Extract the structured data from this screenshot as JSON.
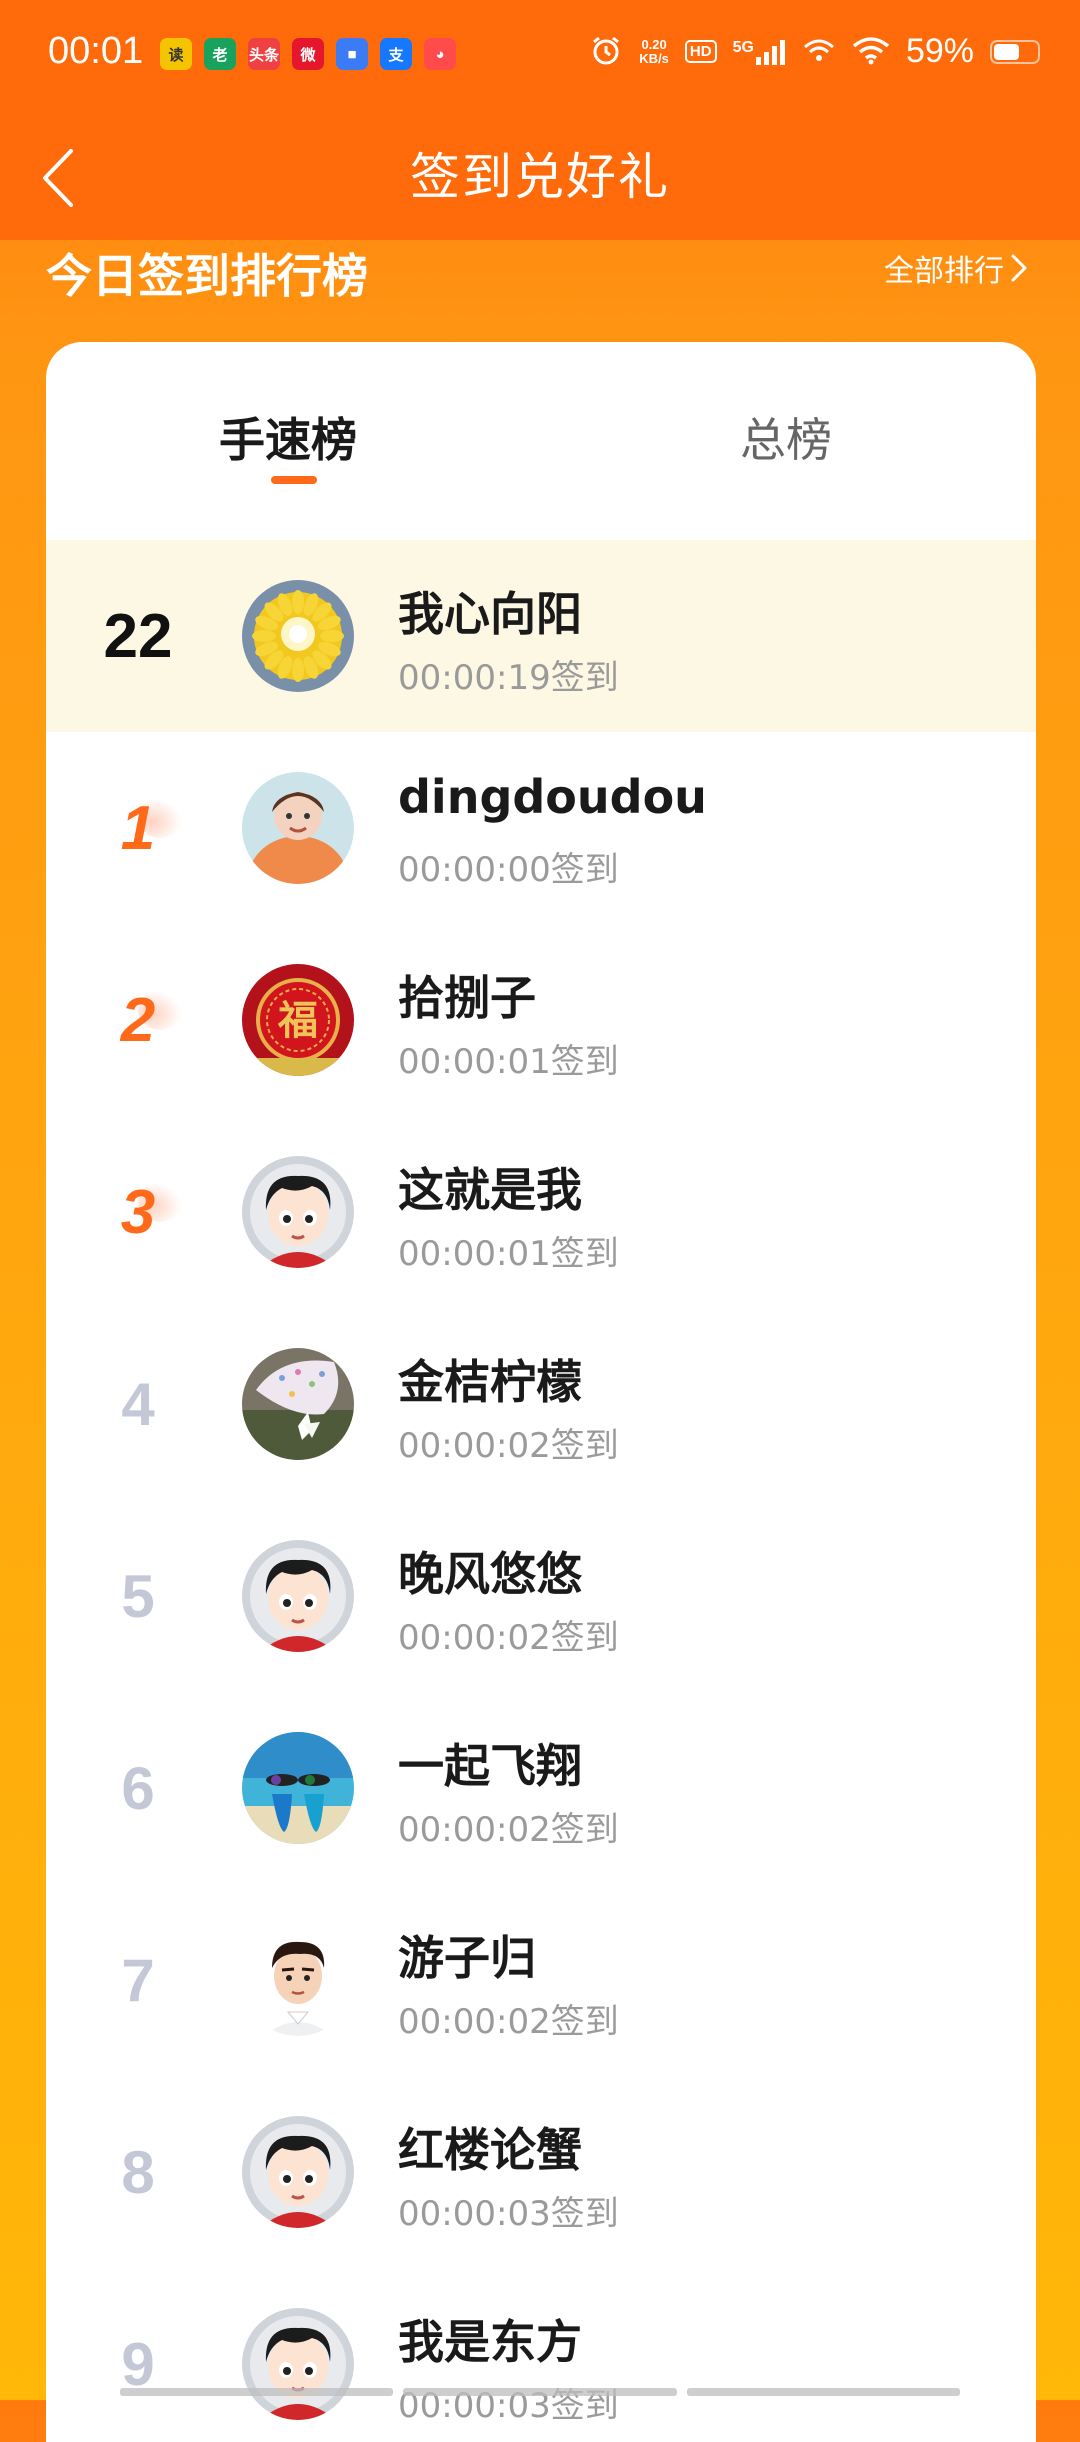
{
  "status_bar": {
    "time": "00:01",
    "app_icons": [
      {
        "label": "读",
        "color": "#F5C400",
        "text_color": "#333",
        "name": "reading-app-icon"
      },
      {
        "label": "老",
        "color": "#19A25B",
        "text_color": "#fff",
        "name": "elder-app-icon"
      },
      {
        "label": "头条",
        "color": "#F04142",
        "text_color": "#fff",
        "name": "toutiao-app-icon"
      },
      {
        "label": "微",
        "color": "#E6162D",
        "text_color": "#fff",
        "name": "weibo-app-icon"
      },
      {
        "label": "■",
        "color": "#3B7BF5",
        "text_color": "#fff",
        "name": "card-app-icon"
      },
      {
        "label": "支",
        "color": "#1677FF",
        "text_color": "#fff",
        "name": "alipay-app-icon"
      },
      {
        "label": "◕",
        "color": "#FF4B4B",
        "text_color": "#fff",
        "name": "mascot-app-icon"
      }
    ],
    "net_speed": "0.20",
    "net_unit": "KB/s",
    "hd_label": "HD",
    "network": "5G",
    "battery_percent": "59%",
    "battery_level": 0.59
  },
  "nav": {
    "title": "签到兑好礼"
  },
  "section": {
    "title": "今日签到排行榜",
    "all_ranking": "全部排行"
  },
  "tabs": [
    {
      "label": "手速榜",
      "active": true
    },
    {
      "label": "总榜",
      "active": false
    }
  ],
  "my_entry": {
    "rank": "22",
    "name": "我心向阳",
    "time": "00:00:19签到",
    "avatar": "sunflower"
  },
  "entries": [
    {
      "rank": "1",
      "name": "dingdoudou",
      "time": "00:00:00签到",
      "avatar": "person-orange"
    },
    {
      "rank": "2",
      "name": "拾捌子",
      "time": "00:00:01签到",
      "avatar": "fu-red"
    },
    {
      "rank": "3",
      "name": "这就是我",
      "time": "00:00:01签到",
      "avatar": "cartoon-default"
    },
    {
      "rank": "4",
      "name": "金桔柠檬",
      "time": "00:00:02签到",
      "avatar": "flower-photo"
    },
    {
      "rank": "5",
      "name": "晚风悠悠",
      "time": "00:00:02签到",
      "avatar": "cartoon-default"
    },
    {
      "rank": "6",
      "name": "一起飞翔",
      "time": "00:00:02签到",
      "avatar": "beach-slippers"
    },
    {
      "rank": "7",
      "name": "游子归",
      "time": "00:00:02签到",
      "avatar": "cartoon-man"
    },
    {
      "rank": "8",
      "name": "红楼论蟹",
      "time": "00:00:03签到",
      "avatar": "cartoon-default"
    },
    {
      "rank": "9",
      "name": "我是东方",
      "time": "00:00:03签到",
      "avatar": "cartoon-default"
    }
  ]
}
